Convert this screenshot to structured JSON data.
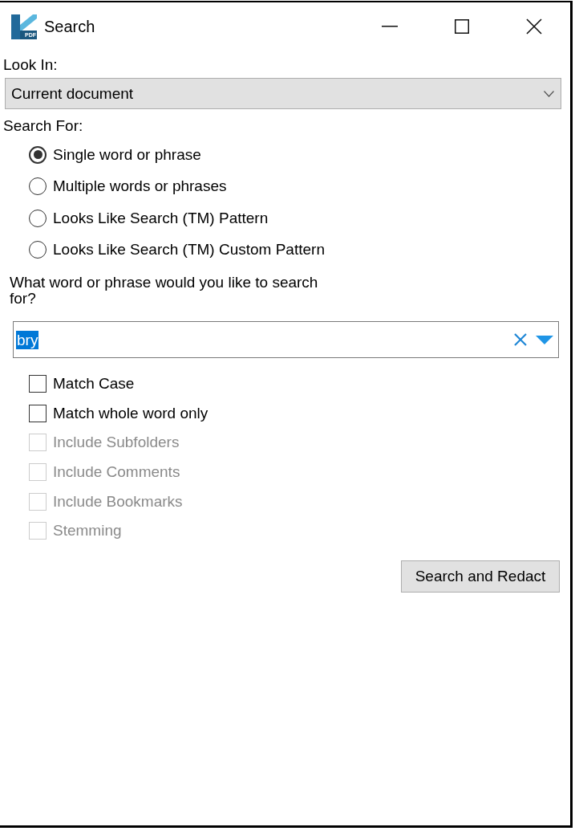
{
  "window": {
    "title": "Search",
    "logo_text": "PDF"
  },
  "look_in": {
    "label": "Look In:",
    "value": "Current document"
  },
  "search_for": {
    "label": "Search For:",
    "options": [
      {
        "label": "Single word or phrase",
        "selected": true
      },
      {
        "label": "Multiple words or phrases",
        "selected": false
      },
      {
        "label": "Looks Like Search (TM) Pattern",
        "selected": false
      },
      {
        "label": "Looks Like Search (TM) Custom Pattern",
        "selected": false
      }
    ]
  },
  "query": {
    "prompt": "What word or phrase would you like to search for?",
    "value": "bry",
    "highlighted": true
  },
  "options": [
    {
      "label": "Match Case",
      "checked": false,
      "disabled": false
    },
    {
      "label": "Match whole word only",
      "checked": false,
      "disabled": false
    },
    {
      "label": "Include Subfolders",
      "checked": false,
      "disabled": true
    },
    {
      "label": "Include Comments",
      "checked": false,
      "disabled": true
    },
    {
      "label": "Include Bookmarks",
      "checked": false,
      "disabled": true
    },
    {
      "label": "Stemming",
      "checked": false,
      "disabled": true
    }
  ],
  "buttons": [
    {
      "label": "Search and Redact"
    }
  ]
}
